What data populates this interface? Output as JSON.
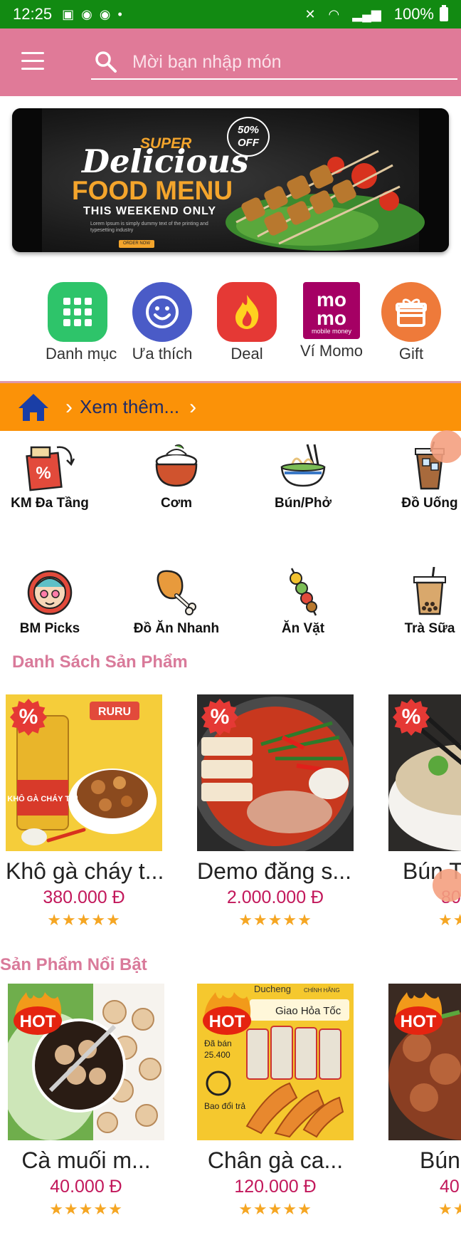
{
  "status_bar": {
    "time": "12:25",
    "battery": "100%"
  },
  "search": {
    "placeholder": "Mời bạn nhập món"
  },
  "banner": {
    "super": "SUPER",
    "delicious": "Delicious",
    "food_menu": "FOOD MENU",
    "weekend": "THIS WEEKEND ONLY",
    "lorem": "Lorem Ipsum is simply dummy text of the printing and typesetting industry",
    "order": "ORDER NOW",
    "off": "50% OFF"
  },
  "quick_actions": [
    {
      "label": "Danh mục",
      "icon": "grid-icon",
      "color": "#2ec46a"
    },
    {
      "label": "Ưa thích",
      "icon": "smile-icon",
      "color": "#4a5bc7"
    },
    {
      "label": "Deal",
      "icon": "flame-icon",
      "color": "#e53935"
    },
    {
      "label": "Ví Momo",
      "icon": "momo-logo",
      "color": "#a50064"
    },
    {
      "label": "Gift",
      "icon": "gift-icon",
      "color": "#ee7a3a"
    }
  ],
  "nav_bar": {
    "more_label": "Xem thêm..."
  },
  "categories": [
    {
      "label": "KM Đa Tầng",
      "icon": "discount-tag-icon"
    },
    {
      "label": "Cơm",
      "icon": "rice-pot-icon"
    },
    {
      "label": "Bún/Phở",
      "icon": "noodle-bowl-icon"
    },
    {
      "label": "Đồ Uống",
      "icon": "iced-coffee-icon"
    },
    {
      "label": "BM Picks",
      "icon": "picks-badge-icon"
    },
    {
      "label": "Đồ Ăn Nhanh",
      "icon": "chicken-leg-icon"
    },
    {
      "label": "Ăn Vặt",
      "icon": "skewer-icon"
    },
    {
      "label": "Trà Sữa",
      "icon": "milk-tea-icon"
    }
  ],
  "product_list": {
    "title": "Danh Sách Sản Phẩm",
    "items": [
      {
        "name": "Khô gà cháy t...",
        "price": "380.000 Đ",
        "badge": "%",
        "rating": 5
      },
      {
        "name": "Demo đăng s...",
        "price": "2.000.000 Đ",
        "badge": "%",
        "rating": 5
      },
      {
        "name": "Bún T",
        "price": "80",
        "badge": "%",
        "rating": 5
      }
    ]
  },
  "featured": {
    "title": "Sản Phẩm Nổi Bật",
    "items": [
      {
        "name": "Cà muối m...",
        "price": "40.000 Đ",
        "badge": "HOT",
        "rating": 5
      },
      {
        "name": "Chân gà ca...",
        "price": "120.000 Đ",
        "badge": "HOT",
        "rating": 5
      },
      {
        "name": "Bún",
        "price": "40",
        "badge": "HOT",
        "rating": 5
      }
    ]
  },
  "product_image_text": {
    "ruru": "RURU",
    "kho_ga": "KHÔ GÀ CHÁY TỎI",
    "ducheng": "Ducheng",
    "chinh_hang": "CHÍNH HÃNG",
    "giao_hoa_toc": "Giao Hỏa Tốc",
    "da_ban": "Đã bán",
    "da_ban_count": "25.400",
    "bao_doi_tra": "Bao đổi trả"
  },
  "stars": "★★★★★",
  "colors": {
    "status_bar": "#128a12",
    "app_bar": "#e07a98",
    "nav_bar": "#fb9208",
    "price": "#c2185b",
    "section_title": "#d97a9a"
  }
}
